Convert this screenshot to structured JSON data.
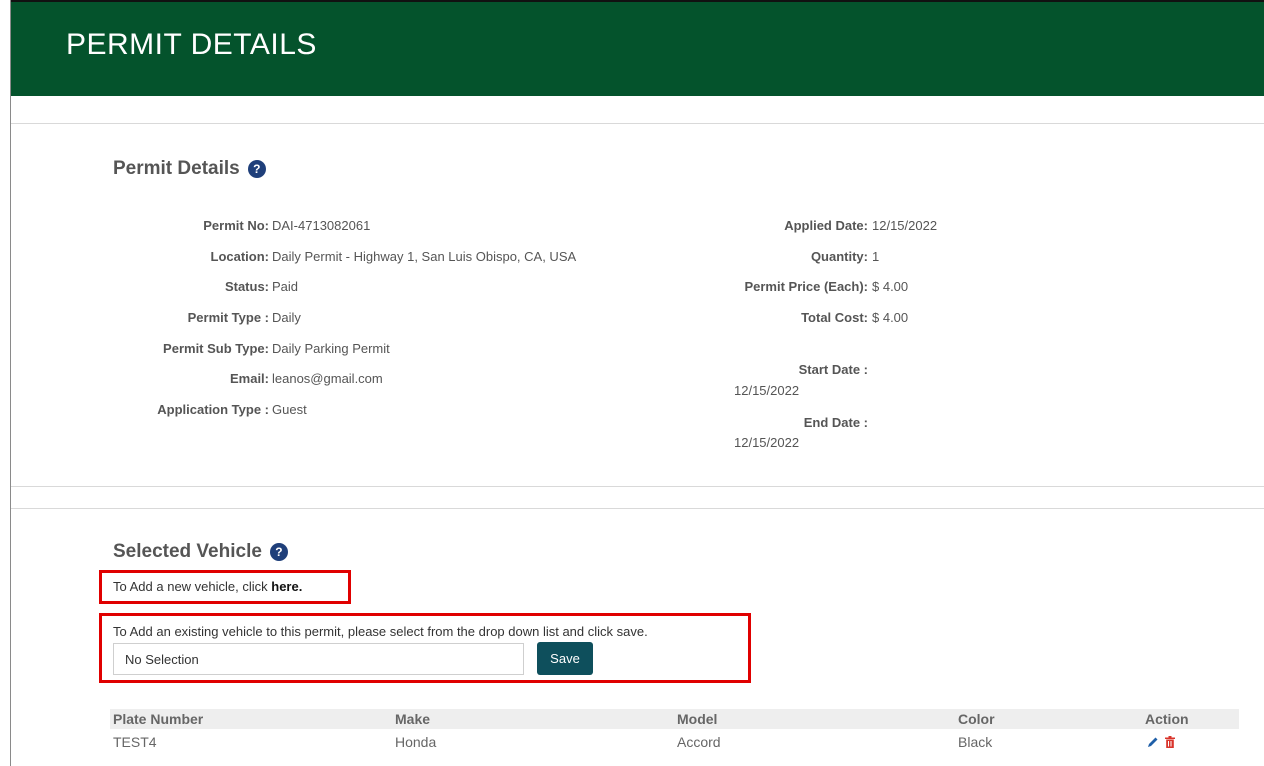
{
  "header": {
    "title": "PERMIT DETAILS"
  },
  "permit_section": {
    "title": "Permit Details",
    "left_fields": [
      {
        "label": "Permit No:",
        "value": "DAI-4713082061"
      },
      {
        "label": "Location:",
        "value": "Daily Permit - Highway 1, San Luis Obispo, CA, USA"
      },
      {
        "label": "Status:",
        "value": "Paid"
      },
      {
        "label": "Permit Type :",
        "value": "Daily"
      },
      {
        "label": "Permit Sub Type:",
        "value": "Daily Parking Permit"
      },
      {
        "label": "Email:",
        "value": "leanos@gmail.com"
      },
      {
        "label": "Application Type :",
        "value": "Guest"
      }
    ],
    "right_fields": [
      {
        "label": "Applied Date:",
        "value": "12/15/2022"
      },
      {
        "label": "Quantity:",
        "value": "1"
      },
      {
        "label": "Permit Price (Each):",
        "value": "$ 4.00"
      },
      {
        "label": "Total Cost:",
        "value": "$ 4.00"
      }
    ],
    "start_date": {
      "label": "Start Date :",
      "value": "12/15/2022"
    },
    "end_date": {
      "label": "End Date :",
      "value": "12/15/2022"
    }
  },
  "vehicle_section": {
    "title": "Selected Vehicle",
    "add_new_prefix": "To Add a new vehicle, click ",
    "add_new_link": "here.",
    "existing_text": "To Add an existing vehicle to this permit, please select from the drop down list and click save.",
    "select_value": "No Selection",
    "save_label": "Save",
    "table": {
      "headers": [
        "Plate Number",
        "Make",
        "Model",
        "Color",
        "Action"
      ],
      "rows": [
        [
          "TEST4",
          "Honda",
          "Accord",
          "Black"
        ]
      ]
    }
  },
  "colors": {
    "header_bg": "#04532c",
    "save_bg": "#0e4f5c",
    "highlight": "#e00000",
    "help_icon": "#1f3f7a",
    "delete_icon": "#d9342b",
    "edit_icon": "#1f5fa8"
  },
  "icons": {
    "help": "question-circle-icon",
    "edit": "pencil-icon",
    "delete": "trash-icon"
  }
}
